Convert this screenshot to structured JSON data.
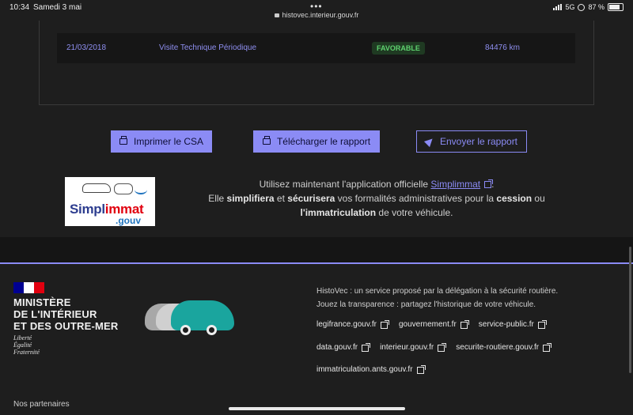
{
  "status_bar": {
    "time": "10:34",
    "date": "Samedi 3 mai",
    "dots": "•••",
    "url": "histovec.interieur.gouv.fr",
    "network": "5G",
    "battery": "87 %"
  },
  "history_row": {
    "date": "21/03/2018",
    "type": "Visite Technique Périodique",
    "result": "FAVORABLE",
    "mileage": "84476 km"
  },
  "buttons": {
    "print_csa": "Imprimer le CSA",
    "download_report": "Télécharger le rapport",
    "send_report": "Envoyer le rapport"
  },
  "promo": {
    "logo_word_1": "Simpl",
    "logo_word_2": "immat",
    "logo_gouv": ".gouv",
    "line1_pre": "Utilisez maintenant l'application officielle ",
    "line1_link": "Simplimmat",
    "line1_post": ".",
    "line2_a": "Elle ",
    "line2_b": "simplifiera",
    "line2_c": " et ",
    "line2_d": "sécurisera",
    "line2_e": " vos formalités administratives pour la ",
    "line2_f": "cession",
    "line2_g": " ou",
    "line3_a": "l'immatriculation",
    "line3_b": " de votre véhicule."
  },
  "footer": {
    "ministry_line1": "MINISTÈRE",
    "ministry_line2": "DE L'INTÉRIEUR",
    "ministry_line3": "ET DES OUTRE-MER",
    "motto_1": "Liberté",
    "motto_2": "Égalité",
    "motto_3": "Fraternité",
    "desc_1": "HistoVec : un service proposé par la délégation à la sécurité routière.",
    "desc_2": "Jouez la transparence : partagez l'historique de votre véhicule.",
    "links_row1": [
      "legifrance.gouv.fr",
      "gouvernement.fr",
      "service-public.fr"
    ],
    "links_row2": [
      "data.gouv.fr",
      "interieur.gouv.fr",
      "securite-routiere.gouv.fr"
    ],
    "links_row3": [
      "immatriculation.ants.gouv.fr"
    ],
    "partners": "Nos partenaires"
  },
  "colors": {
    "accent": "#8b8bf5",
    "badge_bg": "#1f3a22",
    "badge_text": "#5ed16e",
    "background": "#1e1e1e",
    "flag_blue": "#000091",
    "flag_red": "#e1000f"
  }
}
